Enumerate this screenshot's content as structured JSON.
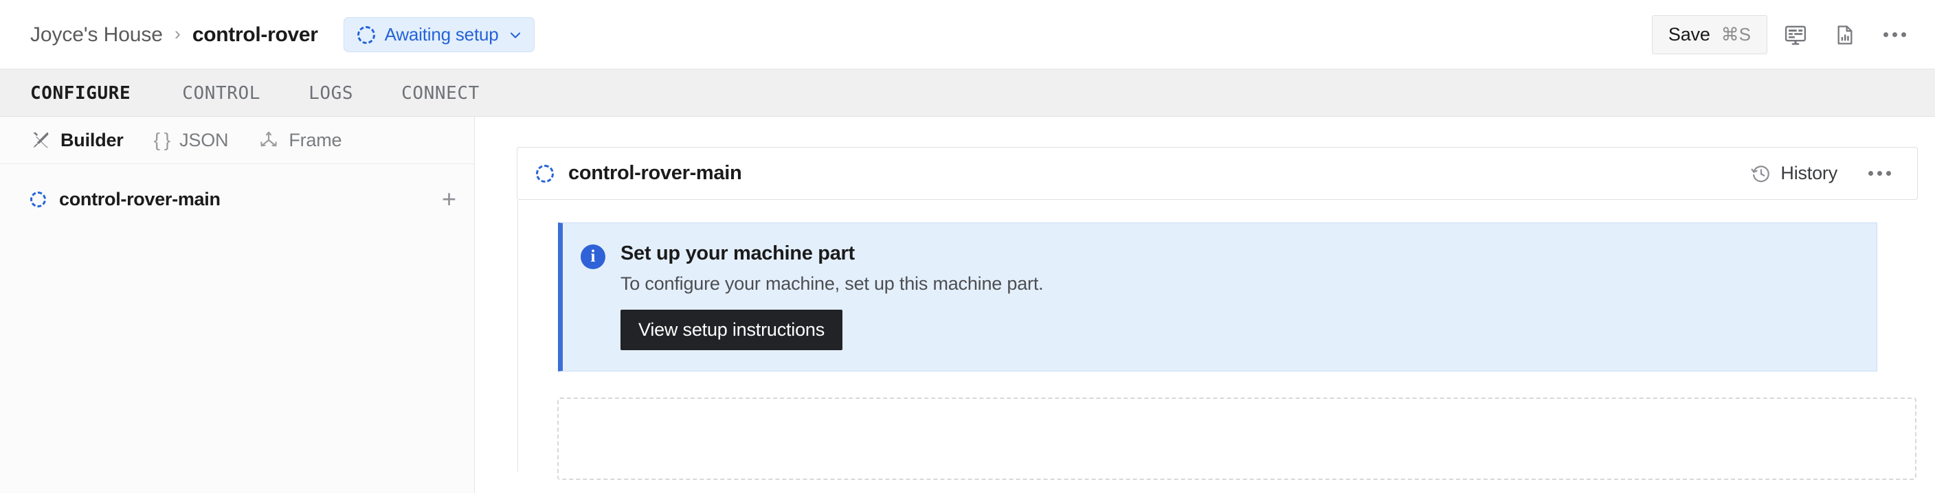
{
  "header": {
    "breadcrumb": {
      "org": "Joyce's House",
      "separator": "›",
      "current": "control-rover"
    },
    "status_pill": {
      "label": "Awaiting setup",
      "icon": "dashed-spinner-icon",
      "chevron": "chevron-down-icon",
      "accent_color": "#2563d8",
      "background_color": "#e3effc"
    },
    "actions": {
      "save_label": "Save",
      "save_shortcut": "⌘S",
      "display_icon": "monitor-icon",
      "report_icon": "document-chart-icon",
      "overflow_icon": "ellipsis-icon"
    }
  },
  "tabs": [
    {
      "label": "CONFIGURE",
      "active": true
    },
    {
      "label": "CONTROL",
      "active": false
    },
    {
      "label": "LOGS",
      "active": false
    },
    {
      "label": "CONNECT",
      "active": false
    }
  ],
  "sidebar": {
    "tools": [
      {
        "label": "Builder",
        "icon": "tools-icon",
        "active": true
      },
      {
        "label": "JSON",
        "icon": "braces-icon",
        "active": false
      },
      {
        "label": "Frame",
        "icon": "axes-icon",
        "active": false
      }
    ],
    "items": [
      {
        "label": "control-rover-main",
        "icon": "dashed-spinner-icon",
        "add_label": "+"
      }
    ]
  },
  "main": {
    "card": {
      "title": "control-rover-main",
      "icon": "dashed-spinner-icon",
      "history_label": "History",
      "history_icon": "clock-rewind-icon",
      "overflow_icon": "ellipsis-icon"
    },
    "banner": {
      "icon": "info-icon",
      "info_glyph": "i",
      "title": "Set up your machine part",
      "description": "To configure your machine, set up this machine part.",
      "button_label": "View setup instructions",
      "accent_color": "#3b6fd6",
      "background_color": "#e4effc"
    }
  }
}
